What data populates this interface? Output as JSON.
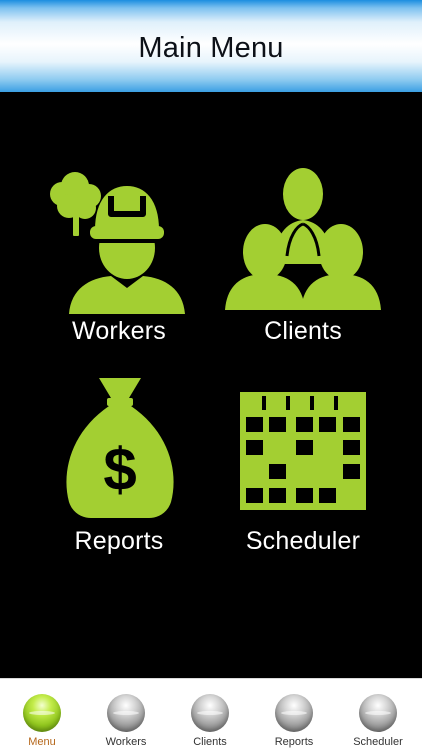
{
  "header": {
    "title": "Main Menu"
  },
  "colors": {
    "accent": "#a3cf32",
    "background": "#000000",
    "active_tab_label": "#b5671b"
  },
  "tiles": [
    {
      "label": "Workers",
      "icon": "worker-with-hard-hat-and-tree-icon"
    },
    {
      "label": "Clients",
      "icon": "group-of-people-icon"
    },
    {
      "label": "Reports",
      "icon": "money-bag-dollar-icon"
    },
    {
      "label": "Scheduler",
      "icon": "calendar-grid-icon"
    }
  ],
  "tabs": [
    {
      "label": "Menu",
      "active": true
    },
    {
      "label": "Workers",
      "active": false
    },
    {
      "label": "Clients",
      "active": false
    },
    {
      "label": "Reports",
      "active": false
    },
    {
      "label": "Scheduler",
      "active": false
    }
  ]
}
